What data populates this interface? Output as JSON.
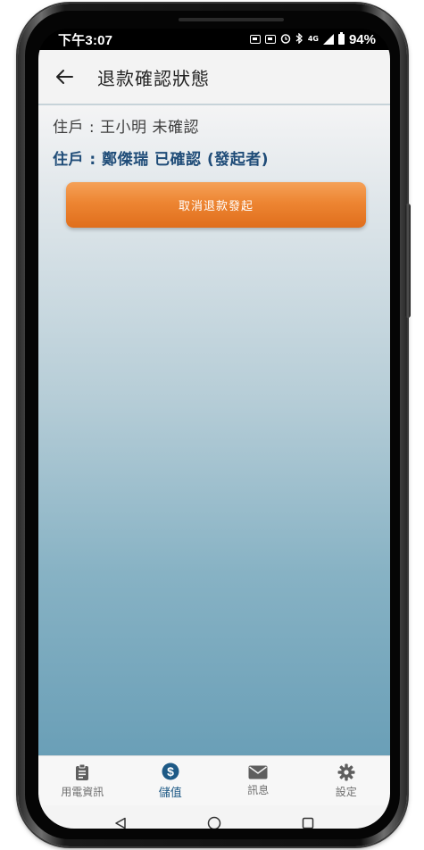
{
  "status_bar": {
    "time": "下午3:07",
    "network": "4G",
    "battery": "94%"
  },
  "app_bar": {
    "back_icon": "arrow-left-icon",
    "title": "退款確認狀態"
  },
  "residents": [
    {
      "text": "住戶 : 王小明 未確認"
    },
    {
      "text": "住戶 : 鄭傑瑞 已確認 (發起者)"
    }
  ],
  "actions": {
    "cancel_refund_label": "取消退款發起",
    "cancel_color": "#ed8532"
  },
  "tabs": [
    {
      "label": "用電資訊",
      "icon": "clipboard-icon",
      "active": false
    },
    {
      "label": "儲值",
      "icon": "dollar-circle-icon",
      "active": true
    },
    {
      "label": "訊息",
      "icon": "envelope-icon",
      "active": false
    },
    {
      "label": "設定",
      "icon": "gear-icon",
      "active": false
    }
  ],
  "colors": {
    "active_tab": "#1e5a86",
    "confirmed_text": "#1f4c78",
    "inactive_tab": "#6f6f6f"
  },
  "nav": {
    "back_icon": "triangle-back-icon",
    "home_icon": "circle-home-icon",
    "recents_icon": "square-recents-icon"
  }
}
